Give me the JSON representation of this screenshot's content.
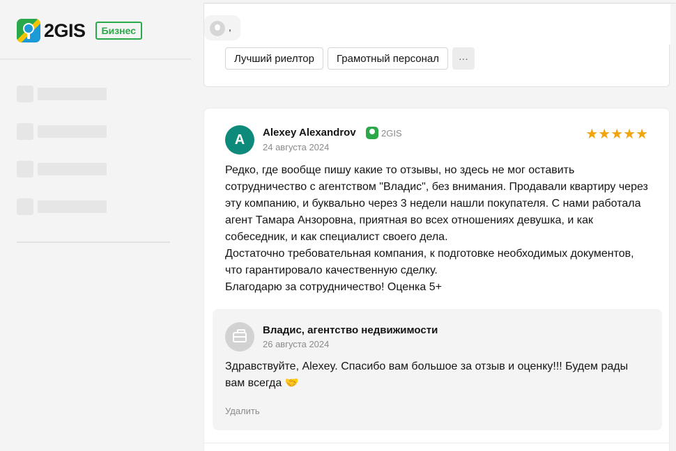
{
  "sidebar": {
    "logo_text": "2GIS",
    "badge": "Бизнес",
    "skeleton_items": 4
  },
  "previous_review": {
    "author_fragment": ",",
    "tags": [
      "Лучший риелтор",
      "Грамотный персонал"
    ],
    "more_label": "···"
  },
  "review": {
    "avatar_letter": "A",
    "author": "Alexey Alexandrov",
    "source": "2GIS",
    "date": "24 августа 2024",
    "rating": 5,
    "stars": "★★★★★",
    "text_lines": [
      "Редко, где вообще пишу какие то отзывы, но здесь не мог оставить сотрудничество с агентством \"Владис\", без внимания. Продавали квартиру через эту компанию, и буквально через 3 недели нашли покупателя. С нами работала агент Тамара Анзоровна, приятная во всех отношениях девушка, и как собеседник, и как специалист своего дела.",
      "Достаточно требовательная компания, к подготовке необходимых документов, что гарантировало качественную сделку.",
      "Благодарю за сотрудничество! Оценка 5+"
    ]
  },
  "reply": {
    "author": "Владис, агентство недвижимости",
    "date": "26 августа 2024",
    "text": "Здравствуйте, Alexey. Спасибо вам большое за отзыв и оценку!!! Будем рады вам всегда 🤝",
    "delete_label": "Удалить"
  },
  "colors": {
    "brand_green": "#2ba84a",
    "avatar_teal": "#0e8a7b",
    "star": "#f2a40d",
    "muted_text": "#8a8a8a"
  }
}
